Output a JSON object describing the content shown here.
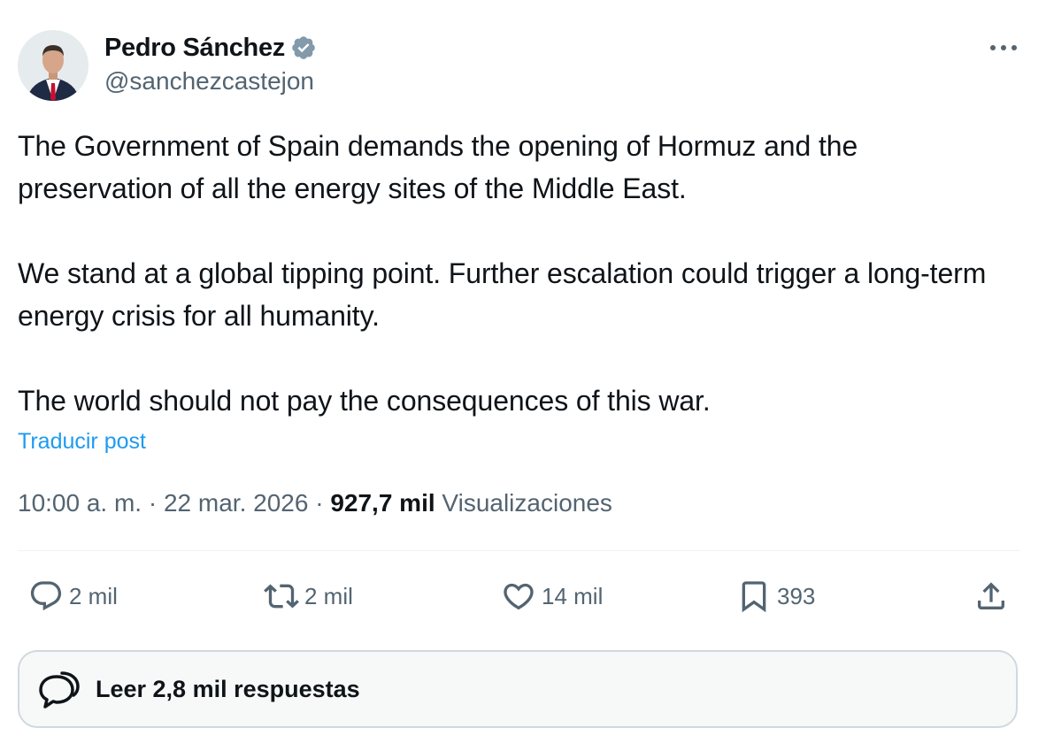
{
  "author": {
    "name": "Pedro Sánchez",
    "handle": "@sanchezcastejon",
    "verified_icon": "verified-badge-icon",
    "verified_color": "#829aab"
  },
  "tweet": {
    "text": "The Government of Spain demands the opening of Hormuz and the preservation of all the energy sites of the Middle East.\n\nWe stand at a global tipping point. Further escalation could trigger a long-term energy crisis for all humanity.\n\nThe world should not pay the consequences of this war.",
    "translate_label": "Traducir post",
    "time": "10:00 a. m.",
    "separator": "·",
    "date": "22 mar. 2026",
    "views_count": "927,7 mil",
    "views_label": "Visualizaciones"
  },
  "actions": {
    "replies": "2 mil",
    "reposts": "2 mil",
    "likes": "14 mil",
    "bookmarks": "393",
    "icons": [
      "reply-icon",
      "repost-icon",
      "like-icon",
      "bookmark-icon",
      "share-icon"
    ]
  },
  "read_replies": {
    "label": "Leer 2,8 mil respuestas"
  },
  "colors": {
    "text": "#0f1419",
    "secondary": "#536471",
    "link": "#1d9bf0",
    "border": "#cfd9de"
  }
}
